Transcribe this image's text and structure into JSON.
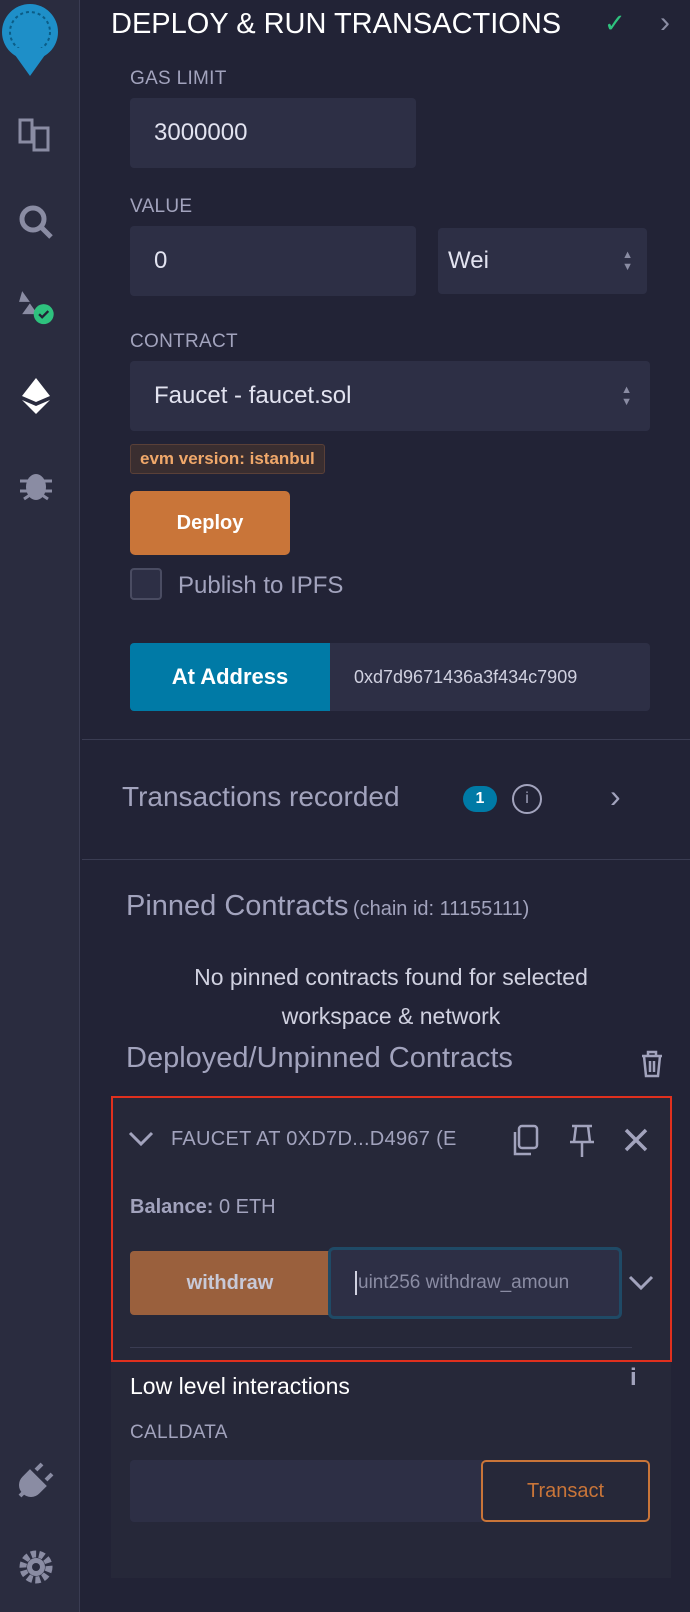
{
  "header": {
    "title": "DEPLOY & RUN TRANSACTIONS"
  },
  "sidebar": {
    "icons": [
      "remix-logo-icon",
      "file-explorer-icon",
      "search-icon",
      "solidity-compiler-icon",
      "deploy-run-icon",
      "debugger-icon",
      "plugin-manager-icon",
      "settings-gear-icon"
    ]
  },
  "form": {
    "gas_limit_label": "GAS LIMIT",
    "gas_limit_value": "3000000",
    "value_label": "VALUE",
    "value_value": "0",
    "value_unit": "Wei",
    "contract_label": "CONTRACT",
    "contract_value": "Faucet - faucet.sol",
    "evm_badge": "evm version: istanbul",
    "deploy_label": "Deploy",
    "publish_label": "Publish to IPFS",
    "at_address_label": "At Address",
    "at_address_value": "0xd7d9671436a3f434c7909"
  },
  "transactions": {
    "label": "Transactions recorded",
    "count": "1"
  },
  "pinned": {
    "title": "Pinned Contracts",
    "chain": "(chain id: 11155111)",
    "empty_line1": "No pinned contracts found for selected",
    "empty_line2": "workspace & network"
  },
  "deployed": {
    "title": "Deployed/Unpinned Contracts",
    "instance_title": "FAUCET AT 0XD7D...D4967 (E",
    "balance_label": "Balance:",
    "balance_value": "0 ETH",
    "function_label": "withdraw",
    "function_placeholder": "uint256 withdraw_amoun",
    "low_level_label": "Low level interactions",
    "calldata_label": "CALLDATA",
    "transact_label": "Transact"
  },
  "colors": {
    "accent_orange": "#c97539",
    "accent_blue": "#007aa6",
    "success": "#2ec27e",
    "highlight": "#e0301e"
  }
}
